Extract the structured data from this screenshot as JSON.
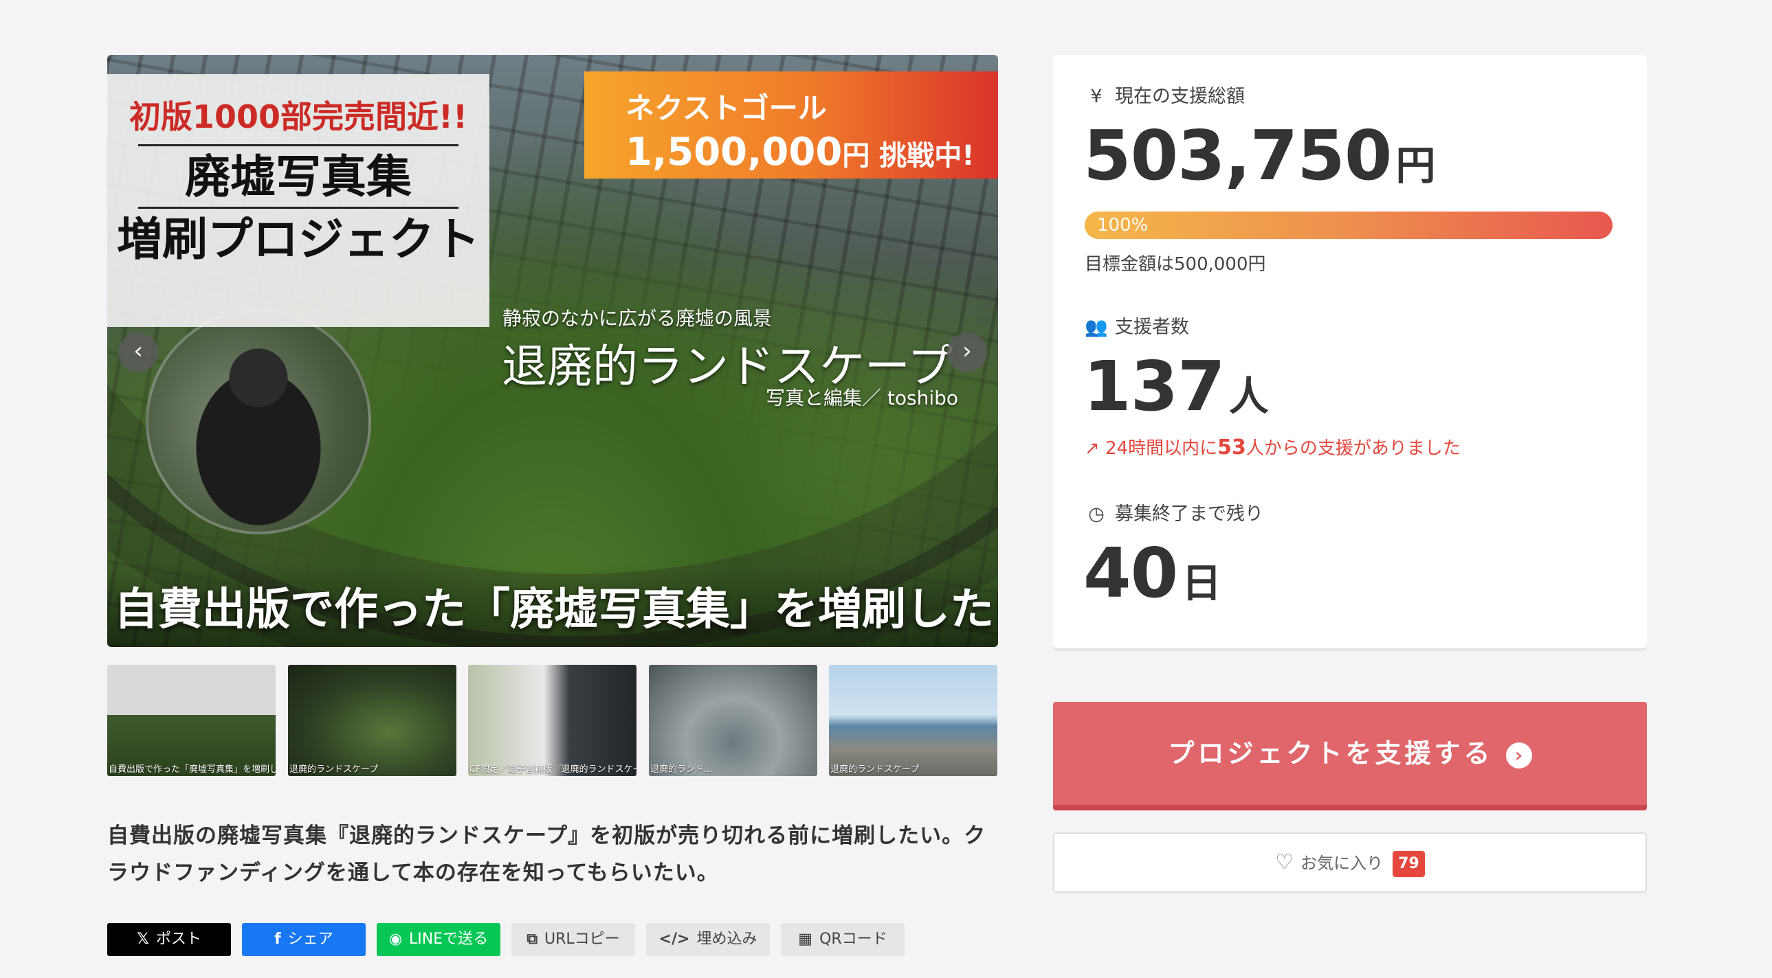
{
  "hero": {
    "badge_red": "初版1000部完売間近!!",
    "title_line1": "廃墟写真集",
    "title_line2": "増刷プロジェクト",
    "goal_label": "ネクストゴール",
    "goal_amount": "1,500,000",
    "goal_suffix": "円 挑戦中!",
    "subtitle_small": "静寂のなかに広がる廃墟の風景",
    "subtitle_book": "退廃的ランドスケープ",
    "credit": "写真と編集／ toshibo",
    "caption": "自費出版で作った「廃墟写真集」を増刷したい！",
    "prev_arrow": "‹",
    "next_arrow": "›"
  },
  "thumbnails": [
    {
      "label": "自費出版で作った「廃墟写真集」を増刷したい!"
    },
    {
      "label": "退廃的ランドスケープ"
    },
    {
      "label": "CF限定／電子書籍版『退廃的ランドスケープ』を追加!"
    },
    {
      "label": "退廃的ランド..."
    },
    {
      "label": "退廃的ランドスケープ"
    }
  ],
  "description": "自費出版の廃墟写真集『退廃的ランドスケープ』を初版が売り切れる前に増刷したい。クラウドファンディングを通して本の存在を知ってもらいたい。",
  "share": {
    "x_icon": "𝕏",
    "x_label": "ポスト",
    "fb_icon": "f",
    "fb_label": "シェア",
    "line_icon": "◉",
    "line_label": "LINEで送る",
    "url_icon": "⧉",
    "url_label": "URLコピー",
    "embed_icon": "</>",
    "embed_label": "埋め込み",
    "qr_icon": "▦",
    "qr_label": "QRコード"
  },
  "stats": {
    "total_icon": "¥",
    "total_label": "現在の支援総額",
    "total_value": "503,750",
    "total_unit": "円",
    "progress_percent": 100,
    "progress_label": "100%",
    "goal_note": "目標金額は500,000円",
    "backers_icon": "👥",
    "backers_label": "支援者数",
    "backers_value": "137",
    "backers_unit": "人",
    "trend_icon": "↗",
    "trend_prefix": "24時間以内に",
    "trend_count": "53",
    "trend_suffix": "人からの支援がありました",
    "remaining_icon": "◷",
    "remaining_label": "募集終了まで残り",
    "remaining_value": "40",
    "remaining_unit": "日"
  },
  "actions": {
    "support_label": "プロジェクトを支援する",
    "support_icon": "›",
    "fav_icon": "♡",
    "fav_label": "お気に入り",
    "fav_count": "79"
  },
  "colors": {
    "accent": "#e0666b",
    "trend": "#e5473d",
    "progress_start": "#f4b74a",
    "progress_end": "#e8584f"
  }
}
